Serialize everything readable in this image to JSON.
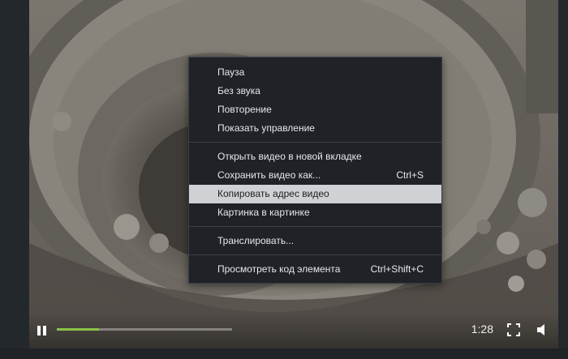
{
  "player": {
    "time": "1:28",
    "progress_played": 0.24,
    "progress_buffered": 0.24,
    "accent_color": "#8bc34a",
    "icons": {
      "play_pause": "pause-icon",
      "fullscreen": "fullscreen-icon",
      "volume": "volume-icon"
    }
  },
  "context_menu": {
    "group1": [
      {
        "label": "Пауза",
        "shortcut": ""
      },
      {
        "label": "Без звука",
        "shortcut": ""
      },
      {
        "label": "Повторение",
        "shortcut": ""
      },
      {
        "label": "Показать управление",
        "shortcut": ""
      }
    ],
    "group2": [
      {
        "label": "Открыть видео в новой вкладке",
        "shortcut": ""
      },
      {
        "label": "Сохранить видео как...",
        "shortcut": "Ctrl+S"
      },
      {
        "label": "Копировать адрес видео",
        "shortcut": "",
        "highlighted": true
      },
      {
        "label": "Картинка в картинке",
        "shortcut": ""
      }
    ],
    "group3": [
      {
        "label": "Транслировать...",
        "shortcut": ""
      }
    ],
    "group4": [
      {
        "label": "Просмотреть код элемента",
        "shortcut": "Ctrl+Shift+C"
      }
    ]
  }
}
